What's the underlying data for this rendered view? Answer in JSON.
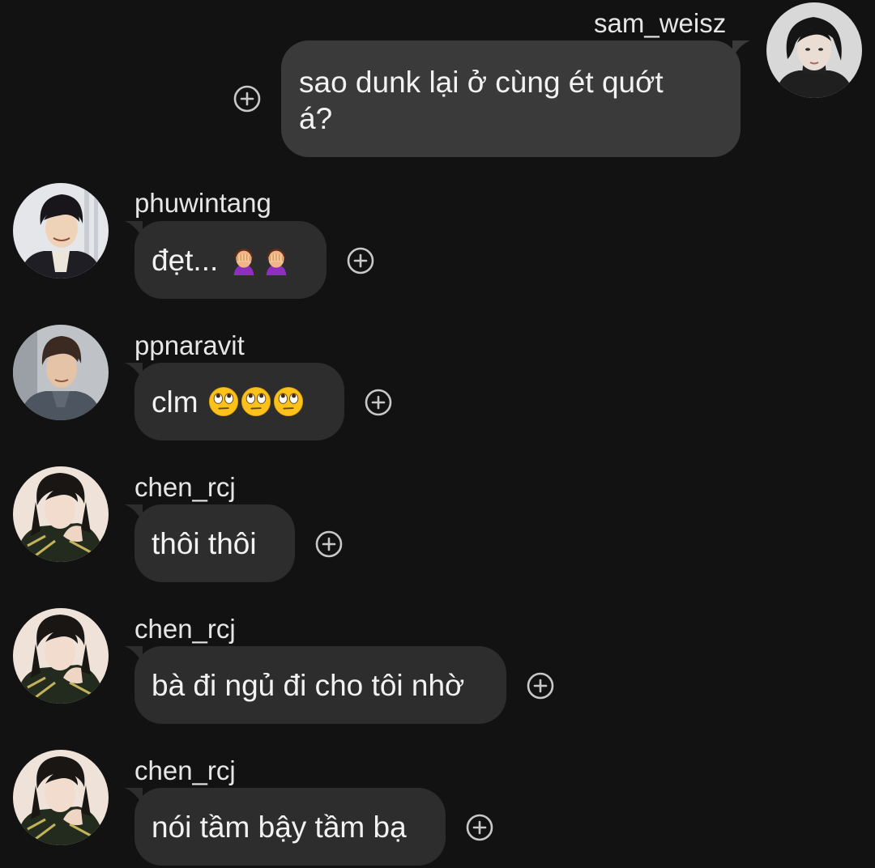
{
  "messages": [
    {
      "sender": "sam_weisz",
      "text_lines": [
        "sao dunk lại ở cùng ét quớt",
        "á?"
      ],
      "direction": "outgoing",
      "avatar_icon": "sam-weisz-avatar"
    },
    {
      "sender": "phuwintang",
      "text": "đẹt... ",
      "emoji": [
        "face-palm-emoji",
        "face-palm-emoji"
      ],
      "direction": "incoming",
      "avatar_icon": "phuwintang-avatar"
    },
    {
      "sender": "ppnaravit",
      "text": "clm ",
      "emoji": [
        "eye-roll-emoji",
        "eye-roll-emoji",
        "eye-roll-emoji"
      ],
      "direction": "incoming",
      "avatar_icon": "ppnaravit-avatar"
    },
    {
      "sender": "chen_rcj",
      "text": "thôi thôi",
      "direction": "incoming",
      "avatar_icon": "chen-rcj-avatar"
    },
    {
      "sender": "chen_rcj",
      "text": "bà đi ngủ đi cho tôi nhờ",
      "direction": "incoming",
      "avatar_icon": "chen-rcj-avatar"
    },
    {
      "sender": "chen_rcj",
      "text": "nói tầm bậy tầm bạ",
      "direction": "incoming",
      "avatar_icon": "chen-rcj-avatar"
    }
  ],
  "icons": {
    "add_reaction": "add-reaction-icon"
  },
  "colors": {
    "background": "#121212",
    "outgoing_bubble": "#3a3a3a",
    "incoming_bubble": "#2d2d2d",
    "text": "#f2f2f2",
    "icon": "#c8c8c8"
  }
}
